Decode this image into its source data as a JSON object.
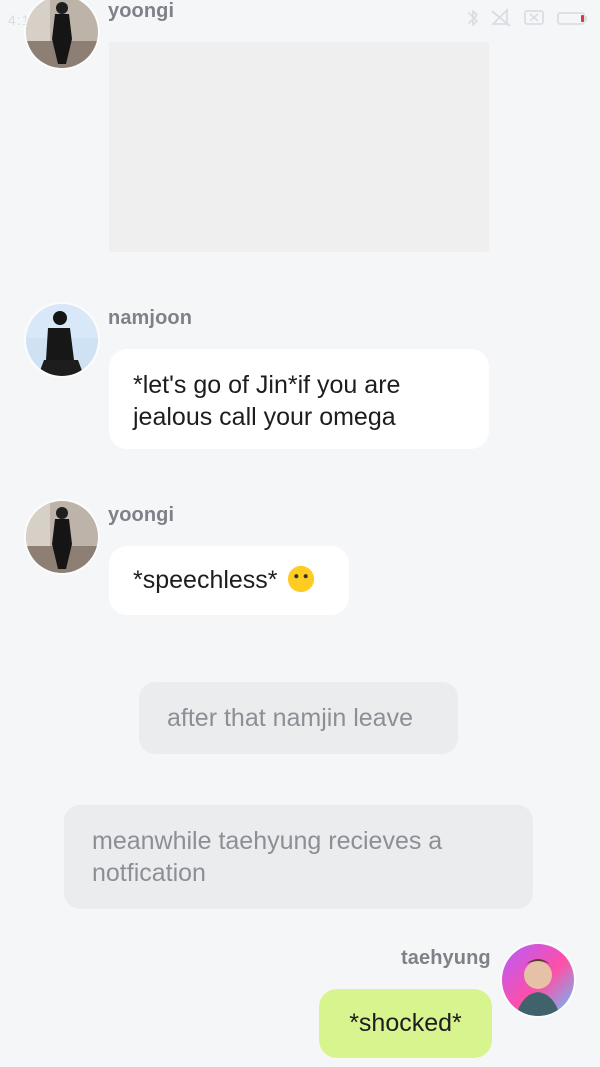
{
  "status_bar": {
    "time": "4:11",
    "icons": [
      "bluetooth-icon",
      "signal-off-icon",
      "screen-icon",
      "battery-icon"
    ]
  },
  "messages": [
    {
      "sender": "yoongi",
      "type": "image",
      "avatar": "avatar-yoongi",
      "image_placeholder_color": "#efefef"
    },
    {
      "sender": "namjoon",
      "type": "text",
      "avatar": "avatar-namjoon",
      "text_lines": [
        "*let's go of Jin*if you are",
        "jealous call your omega"
      ]
    },
    {
      "sender": "yoongi",
      "type": "text",
      "avatar": "avatar-yoongi",
      "text": "*speechless*",
      "emoji": "neutral-face-emoji"
    },
    {
      "type": "narration",
      "text": "after that namjin leave"
    },
    {
      "type": "narration",
      "text_lines": [
        "meanwhile taehyung recieves a",
        "notfication"
      ]
    },
    {
      "sender": "taehyung",
      "type": "text",
      "side": "right",
      "avatar": "avatar-taehyung",
      "text": "*shocked*"
    }
  ],
  "theme": {
    "background": "#f5f6f8",
    "bubble_left": "#ffffff",
    "bubble_right": "#d8f48e",
    "narration": "#ebecee",
    "sender_name": "#7e8288"
  }
}
